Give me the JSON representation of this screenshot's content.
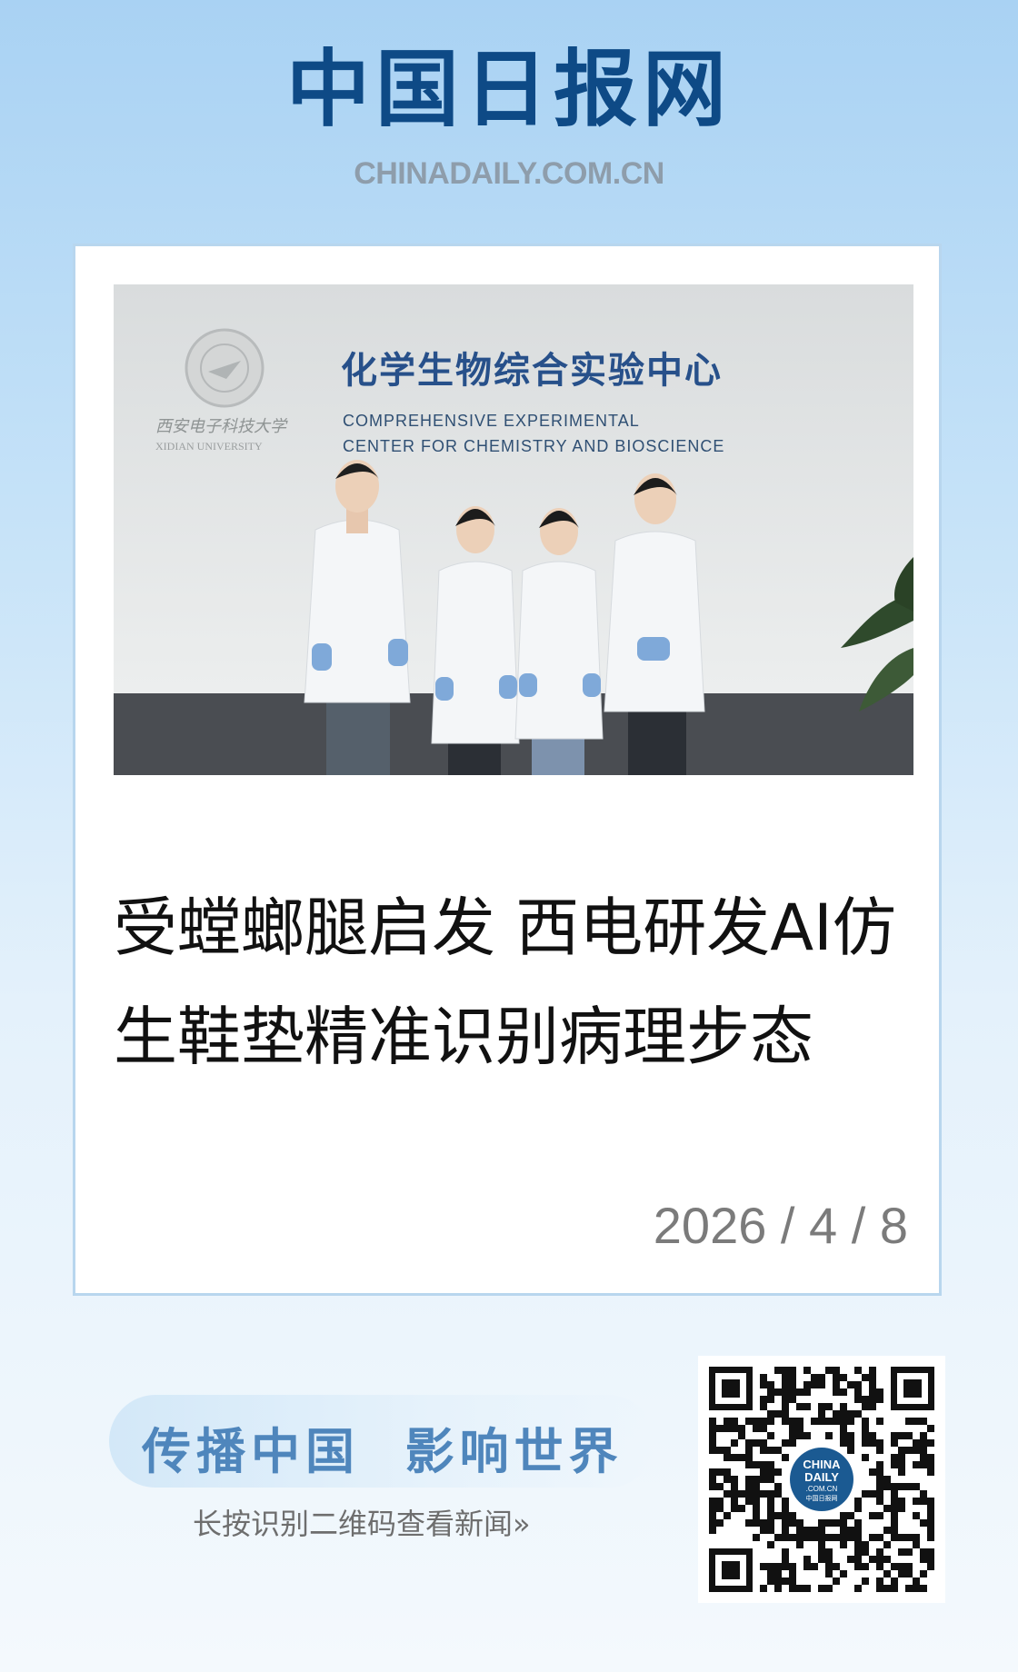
{
  "header": {
    "logo_cn": "中国日报网",
    "logo_en": "CHINADAILY.COM.CN"
  },
  "photo": {
    "sign_title_cn": "化学生物综合实验中心",
    "sign_line1_en": "COMPREHENSIVE EXPERIMENTAL",
    "sign_line2_en": "CENTER FOR CHEMISTRY AND BIOSCIENCE",
    "university_cn": "西安电子科技大学",
    "university_en": "XIDIAN UNIVERSITY"
  },
  "article": {
    "headline": "受螳螂腿启发 西电研发AI仿生鞋垫精准识别病理步态",
    "date": "2026 / 4 / 8"
  },
  "footer": {
    "slogan": "传播中国  影响世界",
    "hint": "长按识别二维码查看新闻»",
    "qr_badge_line1": "CHINA",
    "qr_badge_line2": "DAILY",
    "qr_badge_line3": ".COM.CN",
    "qr_badge_line4": "中国日报网"
  },
  "colors": {
    "brand_blue": "#0e4a86",
    "slogan_blue": "#4f86bc",
    "card_border": "#b8d6ee"
  }
}
